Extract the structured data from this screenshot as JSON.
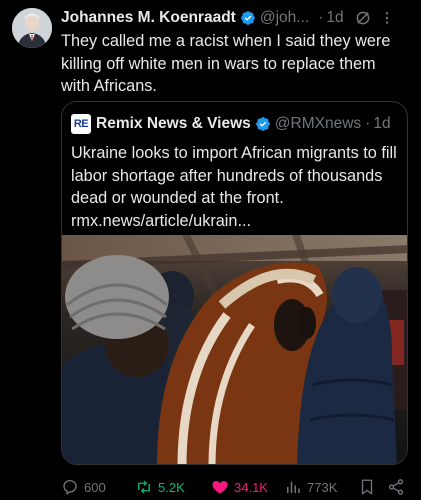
{
  "post": {
    "author_name": "Johannes M. Koenraadt",
    "handle": "@joh...",
    "separator": "·",
    "time": "1d",
    "text": "They called me a racist when I said they were killing off white men in wars to replace them with Africans."
  },
  "quoted": {
    "logo_text": "RE",
    "author_name": "Remix News & Views",
    "handle": "@RMXnews",
    "separator": "·",
    "time": "1d",
    "text": "Ukraine looks to import African migrants to fill labor shortage after hundreds of thousands dead or wounded at the front. rmx.news/article/ukrain..."
  },
  "actions": {
    "replies": "600",
    "reposts": "5.2K",
    "likes": "34.1K",
    "views": "773K"
  },
  "colors": {
    "background": "#000000",
    "text": "#e7e9ea",
    "muted": "#71767b",
    "verified": "#1d9bf0",
    "repost_active": "#00ba7c",
    "like_active": "#f91880",
    "border": "#2f3336"
  },
  "icons": [
    "verified-badge-icon",
    "grok-icon",
    "more-icon",
    "reply-icon",
    "repost-icon",
    "like-icon",
    "views-icon",
    "bookmark-icon",
    "share-icon"
  ]
}
